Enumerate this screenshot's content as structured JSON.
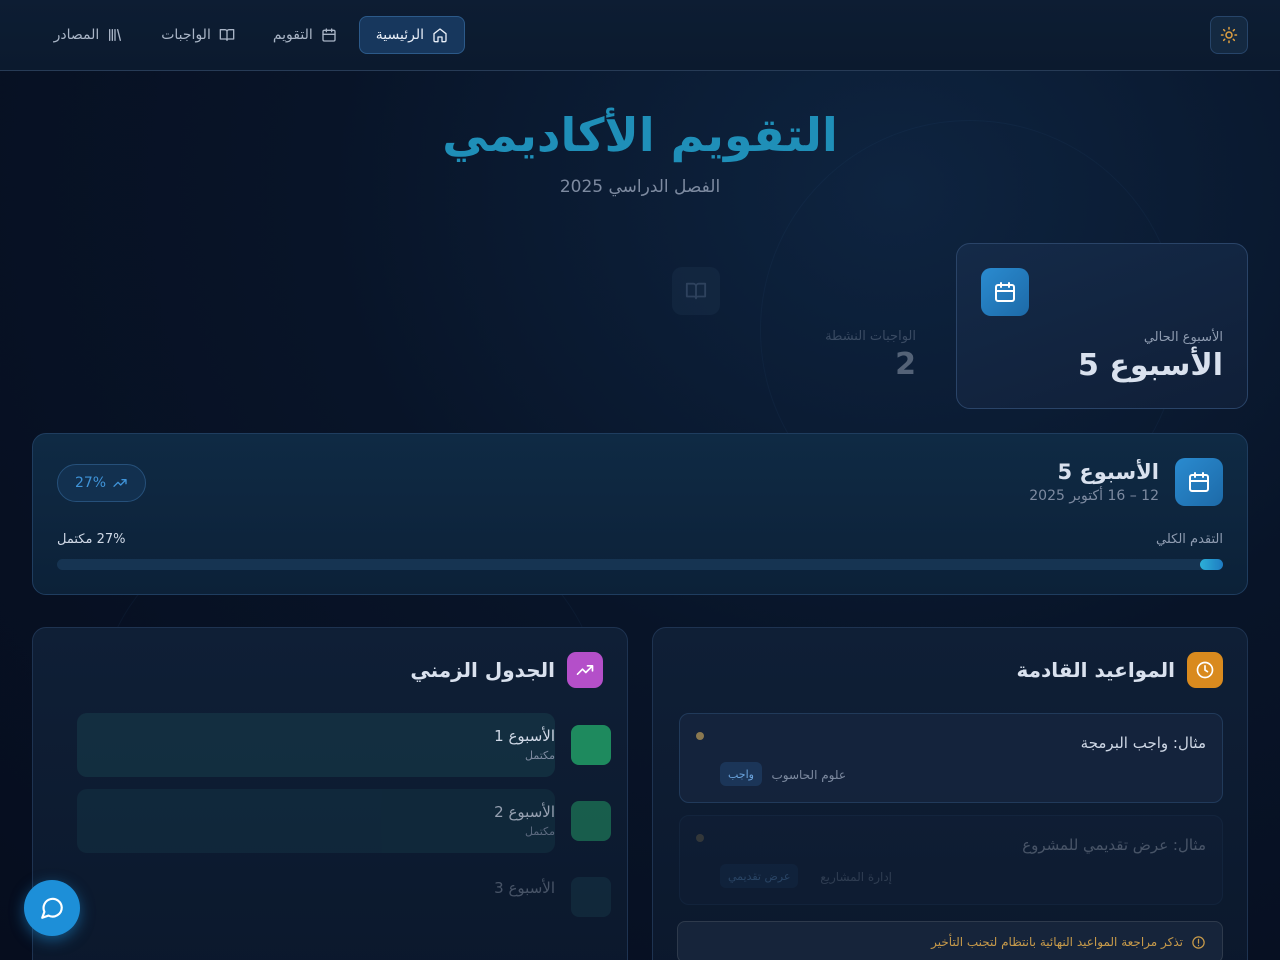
{
  "nav": {
    "items": [
      {
        "label": "الرئيسية",
        "icon": "home-icon",
        "active": true
      },
      {
        "label": "التقويم",
        "icon": "calendar-icon",
        "active": false
      },
      {
        "label": "الواجبات",
        "icon": "book-open-icon",
        "active": false
      },
      {
        "label": "المصادر",
        "icon": "library-icon",
        "active": false
      }
    ],
    "theme_icon": "sun-icon"
  },
  "hero": {
    "title": "التقويم الأكاديمي",
    "subtitle": "الفصل الدراسي 2025"
  },
  "stats": {
    "current_week": {
      "label": "الأسبوع الحالي",
      "value": "الأسبوع 5",
      "icon": "calendar-icon"
    },
    "active_assignments": {
      "label": "الواجبات النشطة",
      "value": "2",
      "icon": "book-open-icon"
    }
  },
  "week": {
    "title": "الأسبوع 5",
    "dates": "12 – 16 أكتوبر 2025",
    "badge": "27%",
    "progress_label": "التقدم الكلي",
    "progress_text": "27% مكتمل",
    "progress_fraction": 0.02
  },
  "deadlines": {
    "title": "المواعيد القادمة",
    "items": [
      {
        "title": "مثال: واجب البرمجة",
        "course": "علوم الحاسوب",
        "tag": "واجب"
      },
      {
        "title": "مثال: عرض تقديمي للمشروع",
        "course": "إدارة المشاريع",
        "tag": "عرض تقديمي"
      }
    ],
    "reminder": "تذكر مراجعة المواعيد النهائية بانتظام لتجنب التأخير"
  },
  "timeline": {
    "title": "الجدول الزمني",
    "weeks": [
      {
        "label": "الأسبوع 1",
        "status": "مكتمل"
      },
      {
        "label": "الأسبوع 2",
        "status": "مكتمل"
      },
      {
        "label": "الأسبوع 3",
        "status": ""
      }
    ]
  },
  "colors": {
    "accent": "#1f8fb8",
    "calendar_icon_bg": "#2a8bd0",
    "clock_icon_bg": "#d98a1e",
    "trend_icon_bg": "#b44fc9",
    "week_complete": "#1e8a5e"
  }
}
